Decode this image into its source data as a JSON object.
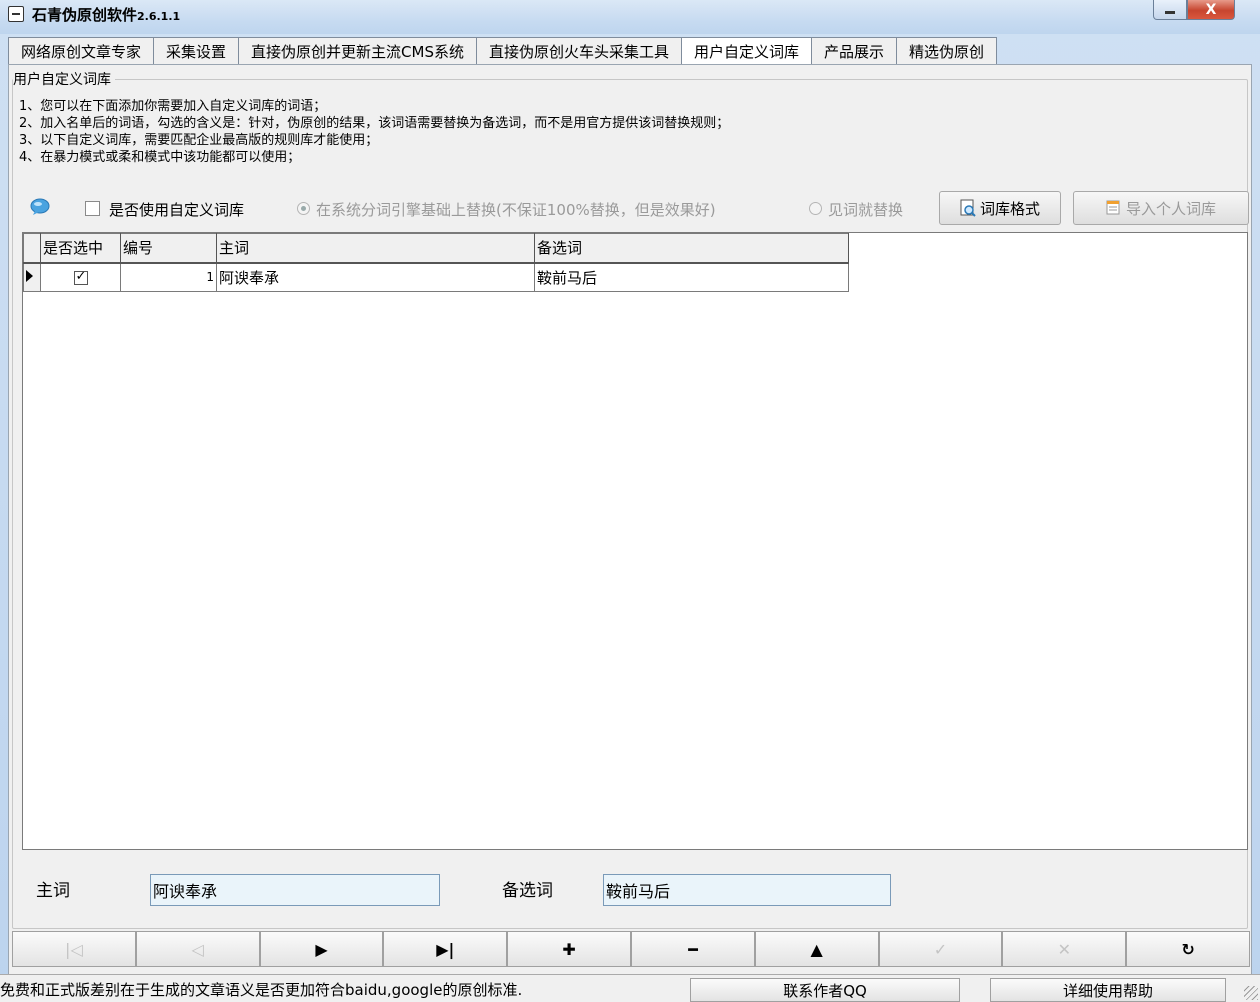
{
  "window": {
    "title": "石青伪原创软件",
    "version": "2.6.1.1",
    "close_glyph": "X"
  },
  "tabs": [
    {
      "label": "网络原创文章专家"
    },
    {
      "label": "采集设置"
    },
    {
      "label": "直接伪原创并更新主流CMS系统"
    },
    {
      "label": "直接伪原创火车头采集工具"
    },
    {
      "label": "用户自定义词库",
      "active": true
    },
    {
      "label": "产品展示"
    },
    {
      "label": "精选伪原创"
    }
  ],
  "group": {
    "title": "用户自定义词库",
    "instructions": [
      "1、您可以在下面添加你需要加入自定义词库的词语；",
      "2、加入名单后的词语，勾选的含义是：针对，伪原创的结果，该词语需要替换为备选词，而不是用官方提供该词替换规则；",
      "3、以下自定义词库，需要匹配企业最高版的规则库才能使用；",
      "4、在暴力模式或柔和模式中该功能都可以使用；"
    ]
  },
  "options": {
    "use_custom_label": "是否使用自定义词库",
    "use_custom_checked": false,
    "radio_engine_label": "在系统分词引擎基础上替换(不保证100%替换，但是效果好)",
    "radio_engine_selected": true,
    "radio_direct_label": "见词就替换",
    "radio_direct_selected": false,
    "format_button": "词库格式",
    "import_button": "导入个人词库"
  },
  "grid": {
    "columns": [
      "是否选中",
      "编号",
      "主词",
      "备选词"
    ],
    "rows": [
      {
        "selected": true,
        "id": "1",
        "main": "阿谀奉承",
        "alt": "鞍前马后"
      }
    ]
  },
  "editor": {
    "main_label": "主词",
    "main_value": "阿谀奉承",
    "alt_label": "备选词",
    "alt_value": "鞍前马后"
  },
  "navigator": [
    {
      "name": "first",
      "glyph": "|◁",
      "enabled": false
    },
    {
      "name": "prior",
      "glyph": "◁",
      "enabled": false
    },
    {
      "name": "next",
      "glyph": "▶",
      "enabled": true
    },
    {
      "name": "last",
      "glyph": "▶|",
      "enabled": true
    },
    {
      "name": "insert",
      "glyph": "✚",
      "enabled": true
    },
    {
      "name": "delete",
      "glyph": "━",
      "enabled": true
    },
    {
      "name": "edit",
      "glyph": "▲",
      "enabled": true
    },
    {
      "name": "post",
      "glyph": "✓",
      "enabled": false
    },
    {
      "name": "cancel",
      "glyph": "✕",
      "enabled": false
    },
    {
      "name": "refresh",
      "glyph": "↻",
      "enabled": true
    }
  ],
  "status": {
    "message": "免费和正式版差别在于生成的文章语义是否更加符合baidu,google的原创标准.",
    "contact_button": "联系作者QQ",
    "help_button": "详细使用帮助"
  }
}
